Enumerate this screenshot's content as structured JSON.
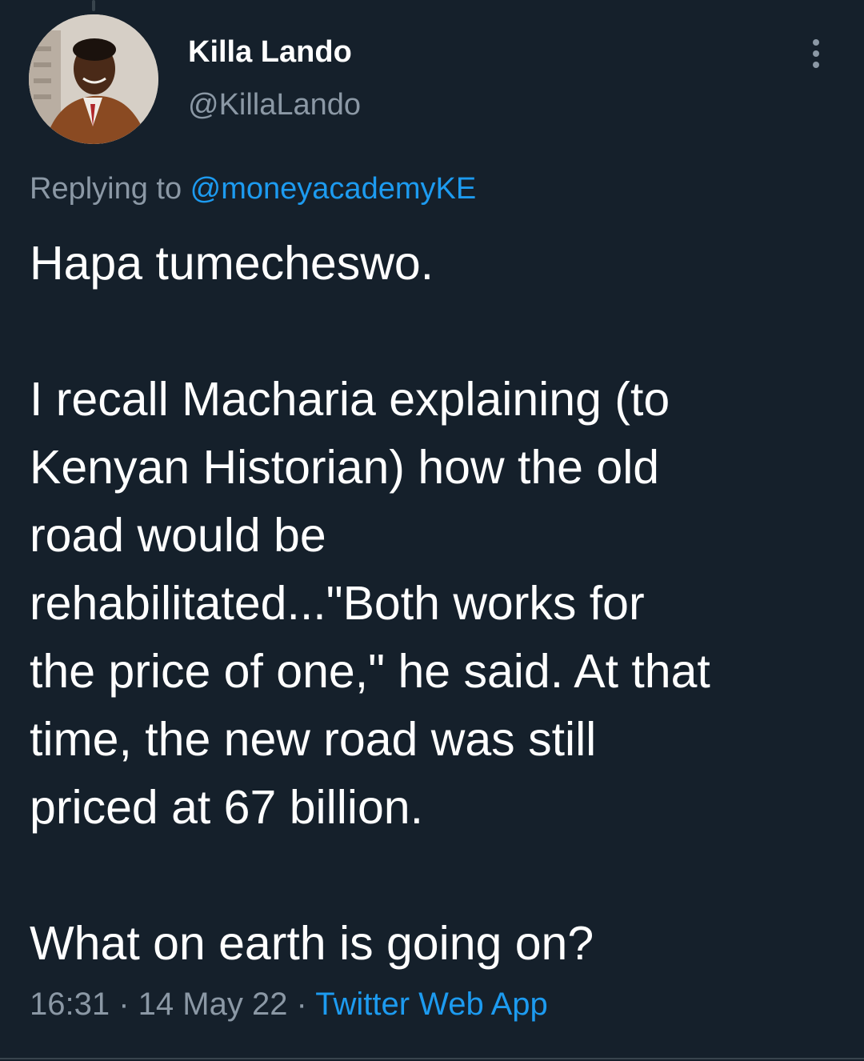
{
  "author": {
    "display_name": "Killa Lando",
    "handle": "@KillaLando",
    "avatar": "profile-photo"
  },
  "reply": {
    "prefix": "Replying to ",
    "mention": "@moneyacademyKE"
  },
  "tweet": {
    "paragraphs": [
      "Hapa tumecheswo.",
      "I recall Macharia explaining (to\nKenyan Historian) how the old\nroad would be\nrehabilitated...\"Both works for\nthe price of one,\" he said. At that\ntime, the new road was still\npriced at 67 billion.",
      "What on earth is going on?"
    ]
  },
  "meta": {
    "time": "16:31",
    "separator": " · ",
    "date": "14 May 22",
    "source": "Twitter Web App"
  },
  "icons": {
    "more": "more-vertical-icon"
  },
  "colors": {
    "background": "#15202b",
    "text": "#ffffff",
    "secondary": "#8b98a5",
    "accent": "#1d9bf0"
  }
}
